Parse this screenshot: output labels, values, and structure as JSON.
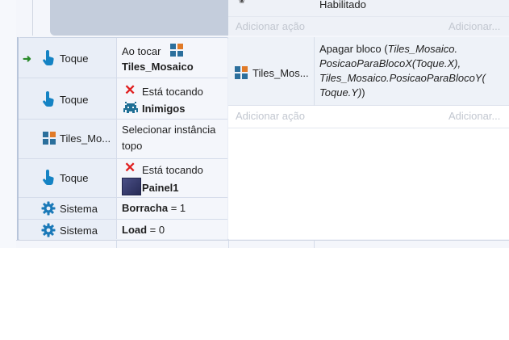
{
  "top_partial": {
    "action_text": "Habilitado",
    "add_action_left": "Adicionar ação",
    "add_action_right": "Adicionar..."
  },
  "event": {
    "conditions": [
      {
        "object": "Toque",
        "icon": "touch-hand-icon",
        "param_line1": "Ao tocar",
        "param_line2": "Tiles_Mosaico",
        "trigger_arrow": true
      },
      {
        "object": "Toque",
        "icon": "touch-hand-icon",
        "param_line1": "Está tocando",
        "param_line2": "Inimigos",
        "negated": true
      },
      {
        "object": "Tiles_Mo...",
        "icon": "tilemap-icon",
        "param_line1": "Selecionar instância",
        "param_line2": "topo"
      },
      {
        "object": "Toque",
        "icon": "touch-hand-icon",
        "param_line1": "Está tocando",
        "param_line2": "Painel1",
        "negated": true
      },
      {
        "object": "Sistema",
        "icon": "gear-icon",
        "param_bold": "Borracha",
        "param_rest": " = 1"
      },
      {
        "object": "Sistema",
        "icon": "gear-icon",
        "param_bold": "Load",
        "param_rest": " = 0"
      }
    ],
    "actions": [
      {
        "object": "Tiles_Mos...",
        "icon": "tilemap-icon",
        "text_plain": "Apagar bloco (",
        "text_italic_1": "Tiles_Mosaico.",
        "text_italic_2": "PosicaoParaBlocoX(Toque.X),",
        "text_italic_3": "Tiles_Mosaico.PosicaoParaBlocoY(",
        "text_italic_4": "Toque.Y)",
        "text_close": ")"
      }
    ],
    "add_action_left": "Adicionar ação",
    "add_action_right": "Adicionar..."
  },
  "colors": {
    "touch_icon": "#1583c4",
    "gear_icon": "#1b79b8",
    "tilemap_icon": "#2b6f9c",
    "negate_x": "#e02020",
    "trigger_arrow": "#2a8a2a",
    "muted_text": "#c2c7d0"
  }
}
